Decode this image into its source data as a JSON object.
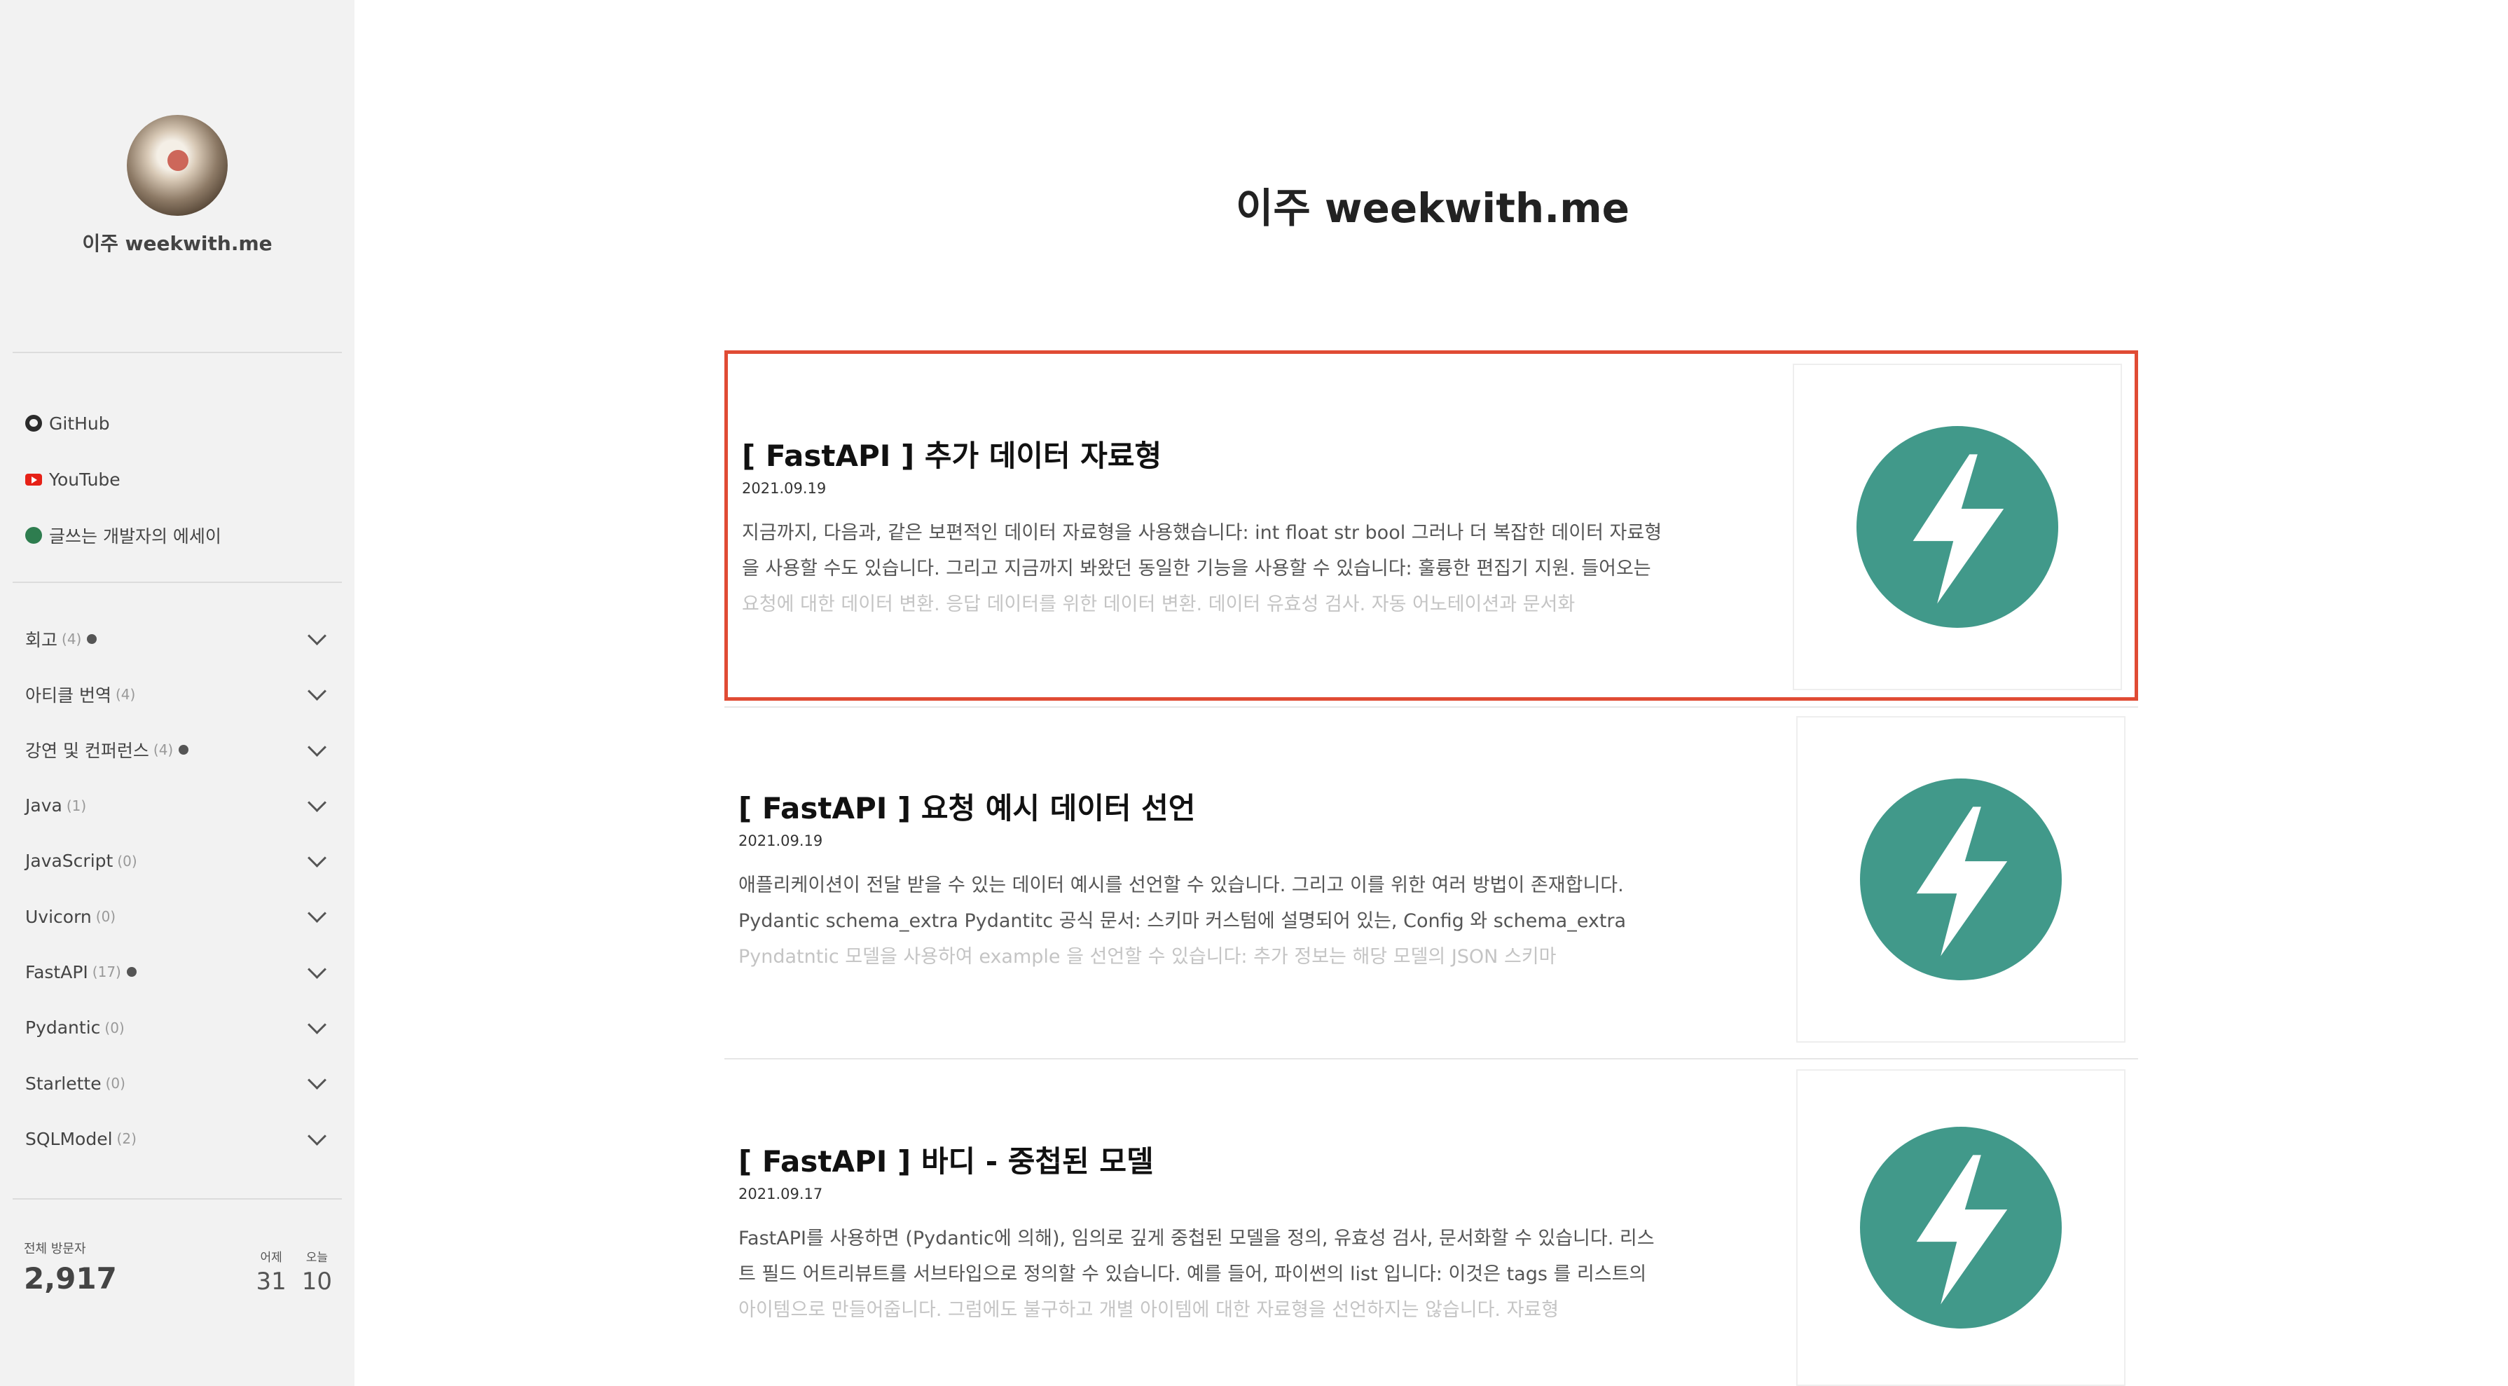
{
  "sidebar": {
    "blog_name": "이주 weekwith.me",
    "links": [
      {
        "label": "GitHub",
        "icon": "github-icon"
      },
      {
        "label": "YouTube",
        "icon": "youtube-icon"
      },
      {
        "label": "글쓰는 개발자의 에세이",
        "icon": "essay-icon"
      }
    ],
    "categories": [
      {
        "name": "회고",
        "count": "(4)",
        "new": true
      },
      {
        "name": "아티클 번역",
        "count": "(4)",
        "new": false
      },
      {
        "name": "강연 및 컨퍼런스",
        "count": "(4)",
        "new": true
      },
      {
        "name": "Java",
        "count": "(1)",
        "new": false
      },
      {
        "name": "JavaScript",
        "count": "(0)",
        "new": false
      },
      {
        "name": "Uvicorn",
        "count": "(0)",
        "new": false
      },
      {
        "name": "FastAPI",
        "count": "(17)",
        "new": true
      },
      {
        "name": "Pydantic",
        "count": "(0)",
        "new": false
      },
      {
        "name": "Starlette",
        "count": "(0)",
        "new": false
      },
      {
        "name": "SQLModel",
        "count": "(2)",
        "new": false
      }
    ],
    "stats": {
      "total_label": "전체 방문자",
      "total": "2,917",
      "yesterday_label": "어제",
      "yesterday": "31",
      "today_label": "오늘",
      "today": "10"
    }
  },
  "main": {
    "title": "이주 weekwith.me",
    "posts": [
      {
        "title": "[ FastAPI ] 추가 데이터 자료형",
        "date": "2021.09.19",
        "excerpt": "지금까지, 다음과, 같은 보편적인 데이터 자료형을 사용했습니다: int float str bool 그러나 더 복잡한 데이터 자료형을 사용할 수도 있습니다. 그리고 지금까지 봐왔던 동일한 기능을 사용할 수 있습니다: 훌륭한 편집기 지원. 들어오는 요청에 대한 데이터 변환. 응답 데이터를 위한 데이터 변환. 데이터 유효성 검사. 자동 어노테이션과 문서화",
        "thumb_icon": "fastapi-logo-icon"
      },
      {
        "title": "[ FastAPI ] 요청 예시 데이터 선언",
        "date": "2021.09.19",
        "excerpt": "애플리케이션이 전달 받을 수 있는 데이터 예시를 선언할 수 있습니다. 그리고 이를 위한 여러 방법이 존재합니다. Pydantic schema_extra Pydantitc 공식 문서: 스키마 커스텀에 설명되어 있는, Config 와 schema_extra Pyndatntic 모델을 사용하여 example 을 선언할 수 있습니다: 추가 정보는 해당 모델의 JSON 스키마",
        "thumb_icon": "fastapi-logo-icon"
      },
      {
        "title": "[ FastAPI ] 바디 - 중첩된 모델",
        "date": "2021.09.17",
        "excerpt": "FastAPI를 사용하면 (Pydantic에 의해), 임의로 깊게 중첩된 모델을 정의, 유효성 검사, 문서화할 수 있습니다. 리스트 필드 어트리뷰트를 서브타입으로 정의할 수 있습니다. 예를 들어, 파이썬의 list 입니다: 이것은 tags 를 리스트의 아이템으로 만들어줍니다. 그럼에도 불구하고 개별 아이템에 대한 자료형을 선언하지는 않습니다. 자료형",
        "thumb_icon": "fastapi-logo-icon"
      }
    ]
  },
  "colors": {
    "sidebar_bg": "#f2f2f2",
    "fastapi_teal": "#41998a",
    "selection_border": "#e04b34"
  }
}
